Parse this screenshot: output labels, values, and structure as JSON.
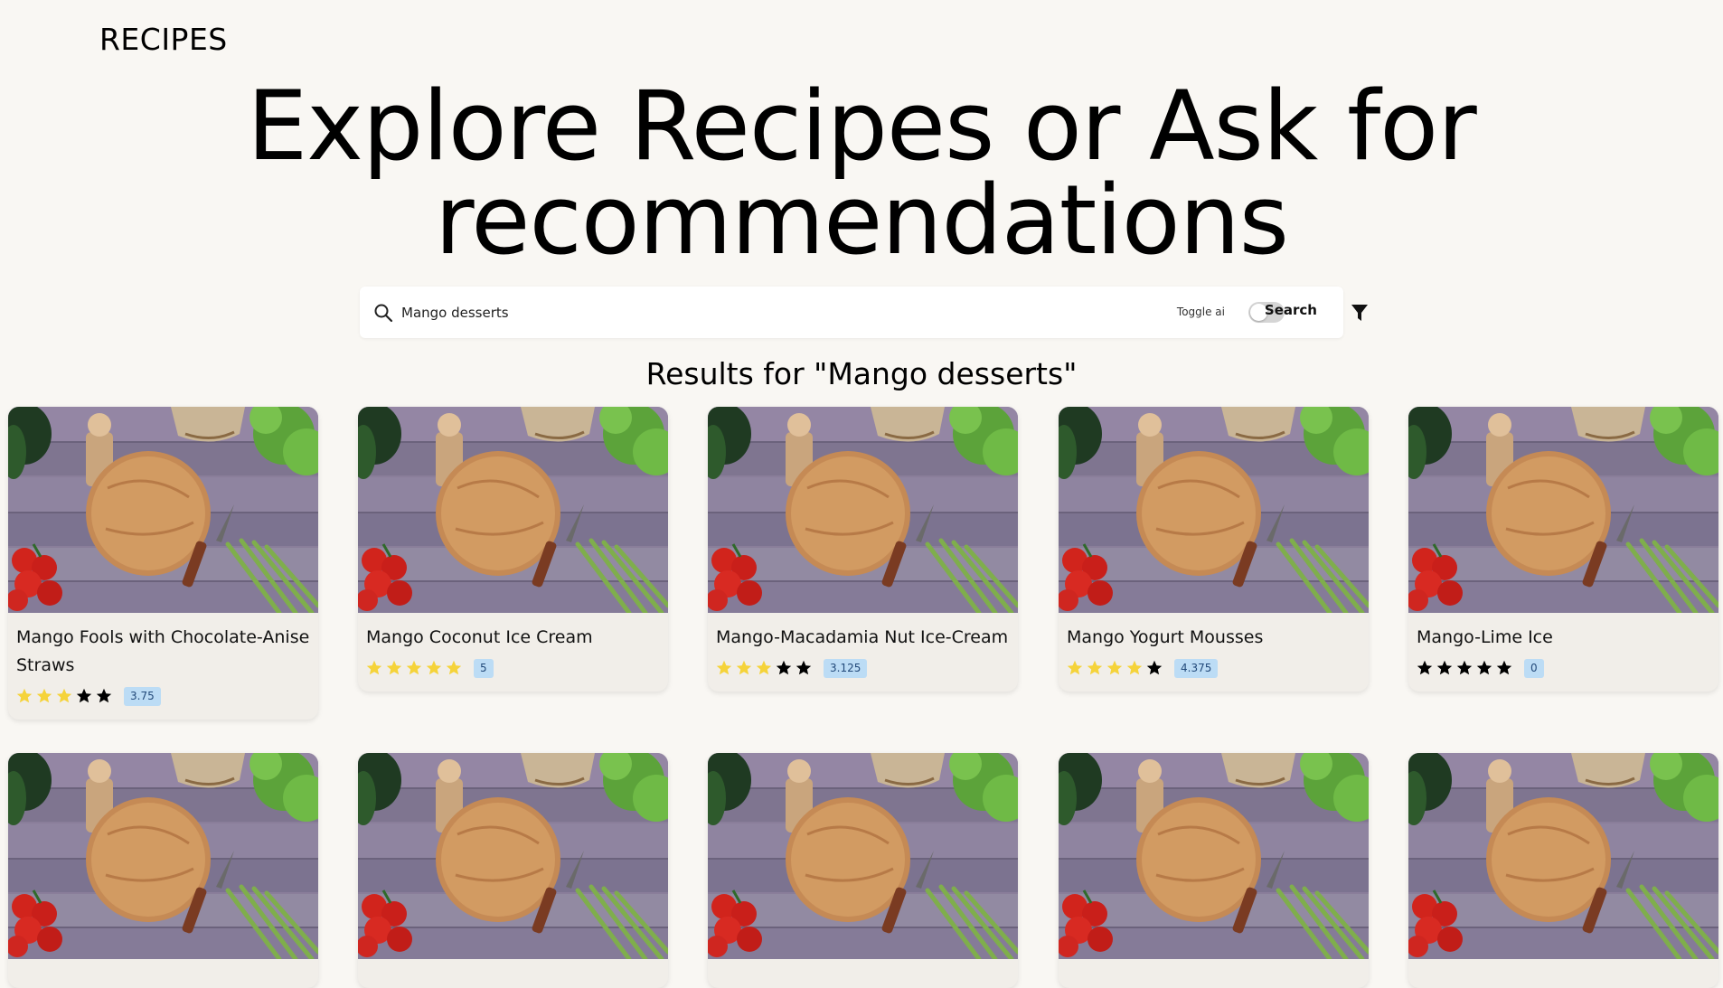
{
  "header": {
    "brand": "RECIPES"
  },
  "hero": {
    "line1": "Explore Recipes or Ask for",
    "line2": "recommendations"
  },
  "search": {
    "value": "Mango desserts",
    "placeholder": "",
    "toggle_label": "Toggle ai",
    "toggle_on": false,
    "button_label": "Search"
  },
  "results": {
    "title": "Results for \"Mango desserts\"",
    "cards": [
      {
        "title": "Mango Fools with Chocolate-Anise Straws",
        "rating": "3.75",
        "stars_filled": 3
      },
      {
        "title": "Mango Coconut Ice Cream",
        "rating": "5",
        "stars_filled": 5
      },
      {
        "title": "Mango-Macadamia Nut Ice-Cream",
        "rating": "3.125",
        "stars_filled": 3
      },
      {
        "title": "Mango Yogurt Mousses",
        "rating": "4.375",
        "stars_filled": 4
      },
      {
        "title": "Mango-Lime Ice",
        "rating": "0",
        "stars_filled": 0
      },
      {
        "title": "",
        "rating": "",
        "stars_filled": 0
      },
      {
        "title": "",
        "rating": "",
        "stars_filled": 0
      },
      {
        "title": "",
        "rating": "",
        "stars_filled": 0
      },
      {
        "title": "",
        "rating": "",
        "stars_filled": 0
      },
      {
        "title": "",
        "rating": "",
        "stars_filled": 0
      }
    ]
  },
  "colors": {
    "background": "#f9f7f3",
    "star_filled": "#f5d33a",
    "star_empty": "#000000",
    "badge_bg": "#bcdcf5"
  },
  "icons": {
    "search": "search-icon",
    "filter": "filter-icon",
    "star": "star-icon"
  }
}
